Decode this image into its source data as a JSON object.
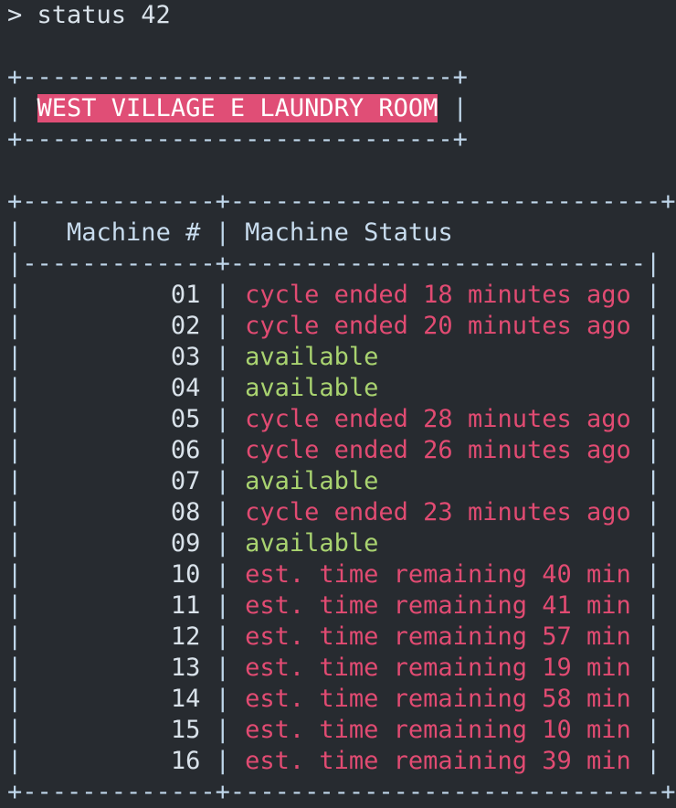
{
  "command": {
    "prompt": "> status 42"
  },
  "title_box": {
    "title": "WEST VILLAGE E LAUNDRY ROOM"
  },
  "table": {
    "headers": {
      "machine": "Machine #",
      "status": "Machine Status"
    },
    "rows": [
      {
        "num": "01",
        "status": "cycle ended 18 minutes ago",
        "state": "busy"
      },
      {
        "num": "02",
        "status": "cycle ended 20 minutes ago",
        "state": "busy"
      },
      {
        "num": "03",
        "status": "available",
        "state": "free"
      },
      {
        "num": "04",
        "status": "available",
        "state": "free"
      },
      {
        "num": "05",
        "status": "cycle ended 28 minutes ago",
        "state": "busy"
      },
      {
        "num": "06",
        "status": "cycle ended 26 minutes ago",
        "state": "busy"
      },
      {
        "num": "07",
        "status": "available",
        "state": "free"
      },
      {
        "num": "08",
        "status": "cycle ended 23 minutes ago",
        "state": "busy"
      },
      {
        "num": "09",
        "status": "available",
        "state": "free"
      },
      {
        "num": "10",
        "status": "est. time remaining 40 min",
        "state": "busy"
      },
      {
        "num": "11",
        "status": "est. time remaining 41 min",
        "state": "busy"
      },
      {
        "num": "12",
        "status": "est. time remaining 57 min",
        "state": "busy"
      },
      {
        "num": "13",
        "status": "est. time remaining 19 min",
        "state": "busy"
      },
      {
        "num": "14",
        "status": "est. time remaining 58 min",
        "state": "busy"
      },
      {
        "num": "15",
        "status": "est. time remaining 10 min",
        "state": "busy"
      },
      {
        "num": "16",
        "status": "est. time remaining 39 min",
        "state": "busy"
      }
    ]
  },
  "colors": {
    "background": "#272b30",
    "busy": "#e14b72",
    "free": "#a9d370",
    "title_highlight": "#e04e76"
  }
}
